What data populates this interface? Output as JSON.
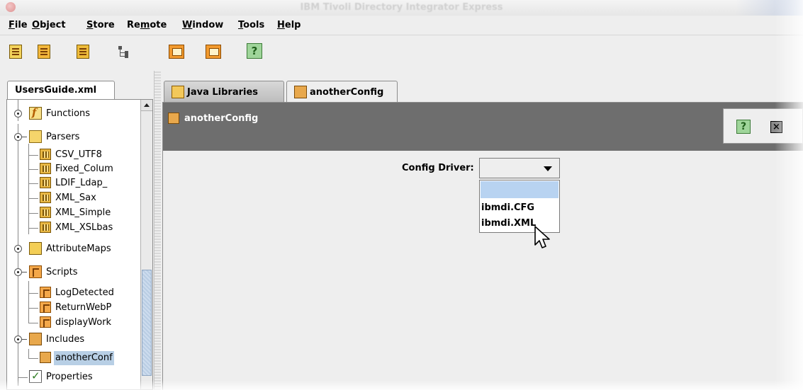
{
  "window": {
    "title": "IBM Tivoli Directory Integrator Express"
  },
  "menubar": {
    "items": [
      {
        "label": "File",
        "mnemonic": "F"
      },
      {
        "label": "Object",
        "mnemonic": "O"
      },
      {
        "label": "Store",
        "mnemonic": "S"
      },
      {
        "label": "Remote",
        "mnemonic": "m"
      },
      {
        "label": "Window",
        "mnemonic": "W"
      },
      {
        "label": "Tools",
        "mnemonic": "T"
      },
      {
        "label": "Help",
        "mnemonic": "H"
      }
    ]
  },
  "toolbar": {
    "buttons": [
      "new-config-icon",
      "open-config-icon",
      "save-config-icon",
      "tree-view-icon",
      "back-icon",
      "forward-icon",
      "help-icon"
    ],
    "help_glyph": "?"
  },
  "left_panel": {
    "tab_label": "UsersGuide.xml",
    "tree": [
      {
        "label": "Functions",
        "icon": "functions-icon"
      },
      {
        "label": "Parsers",
        "icon": "parsers-folder-icon"
      },
      {
        "label": "CSV_UTF8",
        "icon": "parser-icon"
      },
      {
        "label": "Fixed_Colum",
        "icon": "parser-icon"
      },
      {
        "label": "LDIF_Ldap_",
        "icon": "parser-icon"
      },
      {
        "label": "XML_Sax",
        "icon": "parser-icon"
      },
      {
        "label": "XML_Simple",
        "icon": "parser-icon"
      },
      {
        "label": "XML_XSLbas",
        "icon": "parser-icon"
      },
      {
        "label": "AttributeMaps",
        "icon": "attribute-maps-icon"
      },
      {
        "label": "Scripts",
        "icon": "scripts-folder-icon"
      },
      {
        "label": "LogDetected",
        "icon": "script-icon"
      },
      {
        "label": "ReturnWebP",
        "icon": "script-icon"
      },
      {
        "label": "displayWork",
        "icon": "script-icon"
      },
      {
        "label": "Includes",
        "icon": "includes-folder-icon"
      },
      {
        "label": "anotherConf",
        "icon": "include-icon",
        "selected": true
      },
      {
        "label": "Properties",
        "icon": "properties-icon"
      }
    ]
  },
  "right_panel": {
    "tabs": [
      {
        "label": "Java Libraries",
        "active": false
      },
      {
        "label": "anotherConfig",
        "active": true
      }
    ],
    "header": {
      "title": "anotherConfig",
      "help_glyph": "?",
      "close_glyph": "×"
    },
    "config_driver": {
      "label": "Config Driver:",
      "value": "",
      "options": [
        "",
        "ibmdi.CFG",
        "ibmdi.XML"
      ],
      "highlighted_option": ""
    }
  },
  "colors": {
    "header_bar": "#6e6e6e",
    "selection": "#b8d3f1",
    "tree_selection": "#b8cfe5"
  }
}
